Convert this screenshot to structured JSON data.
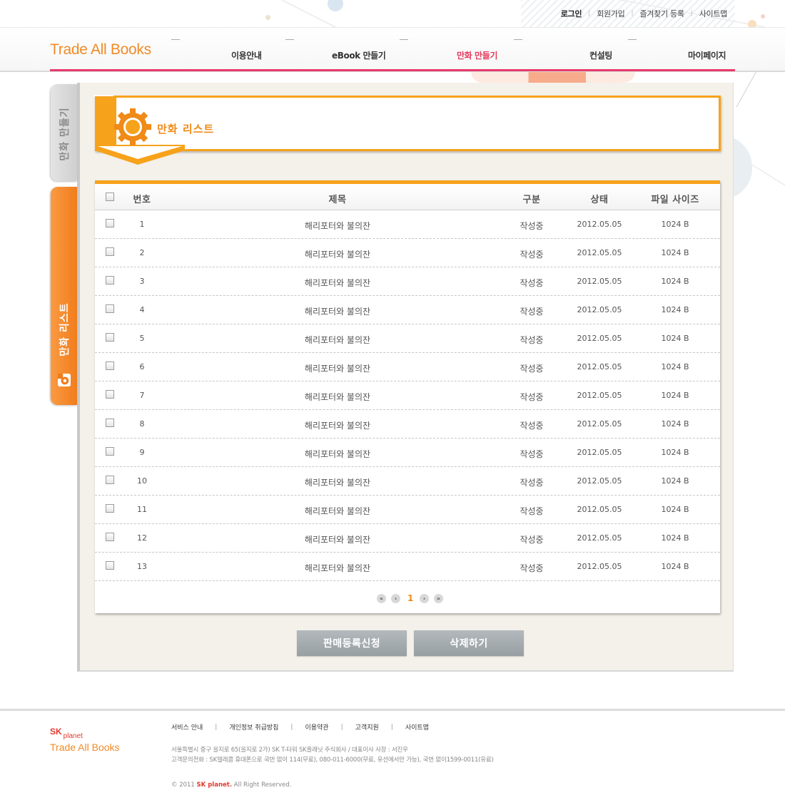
{
  "colors": {
    "brand_orange": "#f08b27",
    "accent_pink": "#e8396b",
    "title_orange": "#f7a21b",
    "button_gray": "#a4aaae",
    "sk_red": "#e23a2e"
  },
  "util_nav": {
    "login": "로그인",
    "join": "회원가입",
    "bookmark": "즐겨찾기 등록",
    "sitemap": "사이트맵"
  },
  "header": {
    "logo": "Trade All Books",
    "menu": [
      "이용안내",
      "eBook 만들기",
      "만화 만들기",
      "컨설팅",
      "마이페이지"
    ],
    "active_menu": "만화 만들기"
  },
  "side_tabs": {
    "make": "만화 만들기",
    "list": "만화 리스트",
    "list_icon": "gear-icon"
  },
  "page": {
    "title": "만화 리스트",
    "title_icon": "gear-icon"
  },
  "table": {
    "headers": {
      "no": "번호",
      "title": "제목",
      "kind": "구분",
      "state": "상태",
      "size": "파일 사이즈"
    },
    "rows": [
      {
        "no": "1",
        "title": "해리포터와 불의잔",
        "kind": "작성중",
        "state": "2012.05.05",
        "size": "1024 B"
      },
      {
        "no": "2",
        "title": "해리포터와 불의잔",
        "kind": "작성중",
        "state": "2012.05.05",
        "size": "1024 B"
      },
      {
        "no": "3",
        "title": "해리포터와 불의잔",
        "kind": "작성중",
        "state": "2012.05.05",
        "size": "1024 B"
      },
      {
        "no": "4",
        "title": "해리포터와 불의잔",
        "kind": "작성중",
        "state": "2012.05.05",
        "size": "1024 B"
      },
      {
        "no": "5",
        "title": "해리포터와 불의잔",
        "kind": "작성중",
        "state": "2012.05.05",
        "size": "1024 B"
      },
      {
        "no": "6",
        "title": "해리포터와 불의잔",
        "kind": "작성중",
        "state": "2012.05.05",
        "size": "1024 B"
      },
      {
        "no": "7",
        "title": "해리포터와 불의잔",
        "kind": "작성중",
        "state": "2012.05.05",
        "size": "1024 B"
      },
      {
        "no": "8",
        "title": "해리포터와 불의잔",
        "kind": "작성중",
        "state": "2012.05.05",
        "size": "1024 B"
      },
      {
        "no": "9",
        "title": "해리포터와 불의잔",
        "kind": "작성중",
        "state": "2012.05.05",
        "size": "1024 B"
      },
      {
        "no": "10",
        "title": "해리포터와 불의잔",
        "kind": "작성중",
        "state": "2012.05.05",
        "size": "1024 B"
      },
      {
        "no": "11",
        "title": "해리포터와 불의잔",
        "kind": "작성중",
        "state": "2012.05.05",
        "size": "1024 B"
      },
      {
        "no": "12",
        "title": "해리포터와 불의잔",
        "kind": "작성중",
        "state": "2012.05.05",
        "size": "1024 B"
      },
      {
        "no": "13",
        "title": "해리포터와 불의잔",
        "kind": "작성중",
        "state": "2012.05.05",
        "size": "1024 B"
      }
    ]
  },
  "pager": {
    "current": "1",
    "first_icon": "double-chevron-left-icon",
    "prev_icon": "chevron-left-icon",
    "next_icon": "chevron-right-icon",
    "last_icon": "double-chevron-right-icon"
  },
  "actions": {
    "sale": "판매등록신청",
    "delete": "삭제하기"
  },
  "footer": {
    "brand_sk": "SK",
    "brand_planet": "planet",
    "logo": "Trade All Books",
    "links": [
      "서비스 안내",
      "개인정보 취급방침",
      "이용약관",
      "고객지원",
      "사이트맵"
    ],
    "address": "서울특별시 중구 을지로 65(을지로 2가) SK T-타워 SK플래닛 주식회사  /  대표이사 사장 : 서진우",
    "contact": "고객문의전화 : SK텔레콤 휴대폰으로 국번 없이 114(무료), 080-011-6000(무료, 유선에서만 가능), 국번 없이1599-0011(유료)",
    "copy_prefix": "© 2011",
    "copy_brand": "SK planet.",
    "copy_suffix": "All Right Reserved."
  }
}
